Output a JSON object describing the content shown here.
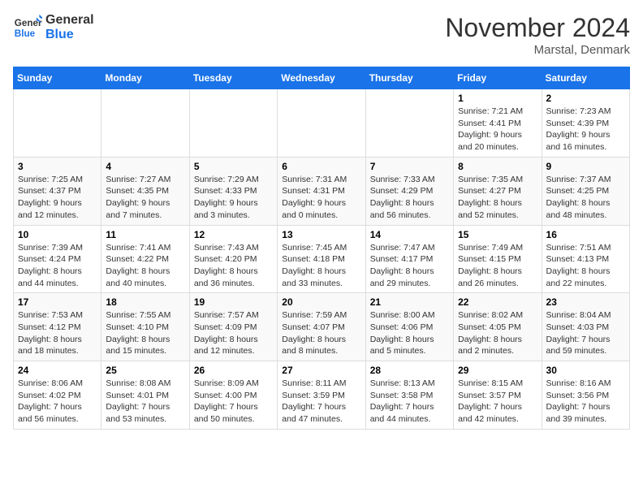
{
  "header": {
    "logo_general": "General",
    "logo_blue": "Blue",
    "month_title": "November 2024",
    "location": "Marstal, Denmark"
  },
  "weekdays": [
    "Sunday",
    "Monday",
    "Tuesday",
    "Wednesday",
    "Thursday",
    "Friday",
    "Saturday"
  ],
  "weeks": [
    [
      {
        "day": "",
        "detail": ""
      },
      {
        "day": "",
        "detail": ""
      },
      {
        "day": "",
        "detail": ""
      },
      {
        "day": "",
        "detail": ""
      },
      {
        "day": "",
        "detail": ""
      },
      {
        "day": "1",
        "detail": "Sunrise: 7:21 AM\nSunset: 4:41 PM\nDaylight: 9 hours and 20 minutes."
      },
      {
        "day": "2",
        "detail": "Sunrise: 7:23 AM\nSunset: 4:39 PM\nDaylight: 9 hours and 16 minutes."
      }
    ],
    [
      {
        "day": "3",
        "detail": "Sunrise: 7:25 AM\nSunset: 4:37 PM\nDaylight: 9 hours and 12 minutes."
      },
      {
        "day": "4",
        "detail": "Sunrise: 7:27 AM\nSunset: 4:35 PM\nDaylight: 9 hours and 7 minutes."
      },
      {
        "day": "5",
        "detail": "Sunrise: 7:29 AM\nSunset: 4:33 PM\nDaylight: 9 hours and 3 minutes."
      },
      {
        "day": "6",
        "detail": "Sunrise: 7:31 AM\nSunset: 4:31 PM\nDaylight: 9 hours and 0 minutes."
      },
      {
        "day": "7",
        "detail": "Sunrise: 7:33 AM\nSunset: 4:29 PM\nDaylight: 8 hours and 56 minutes."
      },
      {
        "day": "8",
        "detail": "Sunrise: 7:35 AM\nSunset: 4:27 PM\nDaylight: 8 hours and 52 minutes."
      },
      {
        "day": "9",
        "detail": "Sunrise: 7:37 AM\nSunset: 4:25 PM\nDaylight: 8 hours and 48 minutes."
      }
    ],
    [
      {
        "day": "10",
        "detail": "Sunrise: 7:39 AM\nSunset: 4:24 PM\nDaylight: 8 hours and 44 minutes."
      },
      {
        "day": "11",
        "detail": "Sunrise: 7:41 AM\nSunset: 4:22 PM\nDaylight: 8 hours and 40 minutes."
      },
      {
        "day": "12",
        "detail": "Sunrise: 7:43 AM\nSunset: 4:20 PM\nDaylight: 8 hours and 36 minutes."
      },
      {
        "day": "13",
        "detail": "Sunrise: 7:45 AM\nSunset: 4:18 PM\nDaylight: 8 hours and 33 minutes."
      },
      {
        "day": "14",
        "detail": "Sunrise: 7:47 AM\nSunset: 4:17 PM\nDaylight: 8 hours and 29 minutes."
      },
      {
        "day": "15",
        "detail": "Sunrise: 7:49 AM\nSunset: 4:15 PM\nDaylight: 8 hours and 26 minutes."
      },
      {
        "day": "16",
        "detail": "Sunrise: 7:51 AM\nSunset: 4:13 PM\nDaylight: 8 hours and 22 minutes."
      }
    ],
    [
      {
        "day": "17",
        "detail": "Sunrise: 7:53 AM\nSunset: 4:12 PM\nDaylight: 8 hours and 18 minutes."
      },
      {
        "day": "18",
        "detail": "Sunrise: 7:55 AM\nSunset: 4:10 PM\nDaylight: 8 hours and 15 minutes."
      },
      {
        "day": "19",
        "detail": "Sunrise: 7:57 AM\nSunset: 4:09 PM\nDaylight: 8 hours and 12 minutes."
      },
      {
        "day": "20",
        "detail": "Sunrise: 7:59 AM\nSunset: 4:07 PM\nDaylight: 8 hours and 8 minutes."
      },
      {
        "day": "21",
        "detail": "Sunrise: 8:00 AM\nSunset: 4:06 PM\nDaylight: 8 hours and 5 minutes."
      },
      {
        "day": "22",
        "detail": "Sunrise: 8:02 AM\nSunset: 4:05 PM\nDaylight: 8 hours and 2 minutes."
      },
      {
        "day": "23",
        "detail": "Sunrise: 8:04 AM\nSunset: 4:03 PM\nDaylight: 7 hours and 59 minutes."
      }
    ],
    [
      {
        "day": "24",
        "detail": "Sunrise: 8:06 AM\nSunset: 4:02 PM\nDaylight: 7 hours and 56 minutes."
      },
      {
        "day": "25",
        "detail": "Sunrise: 8:08 AM\nSunset: 4:01 PM\nDaylight: 7 hours and 53 minutes."
      },
      {
        "day": "26",
        "detail": "Sunrise: 8:09 AM\nSunset: 4:00 PM\nDaylight: 7 hours and 50 minutes."
      },
      {
        "day": "27",
        "detail": "Sunrise: 8:11 AM\nSunset: 3:59 PM\nDaylight: 7 hours and 47 minutes."
      },
      {
        "day": "28",
        "detail": "Sunrise: 8:13 AM\nSunset: 3:58 PM\nDaylight: 7 hours and 44 minutes."
      },
      {
        "day": "29",
        "detail": "Sunrise: 8:15 AM\nSunset: 3:57 PM\nDaylight: 7 hours and 42 minutes."
      },
      {
        "day": "30",
        "detail": "Sunrise: 8:16 AM\nSunset: 3:56 PM\nDaylight: 7 hours and 39 minutes."
      }
    ]
  ]
}
